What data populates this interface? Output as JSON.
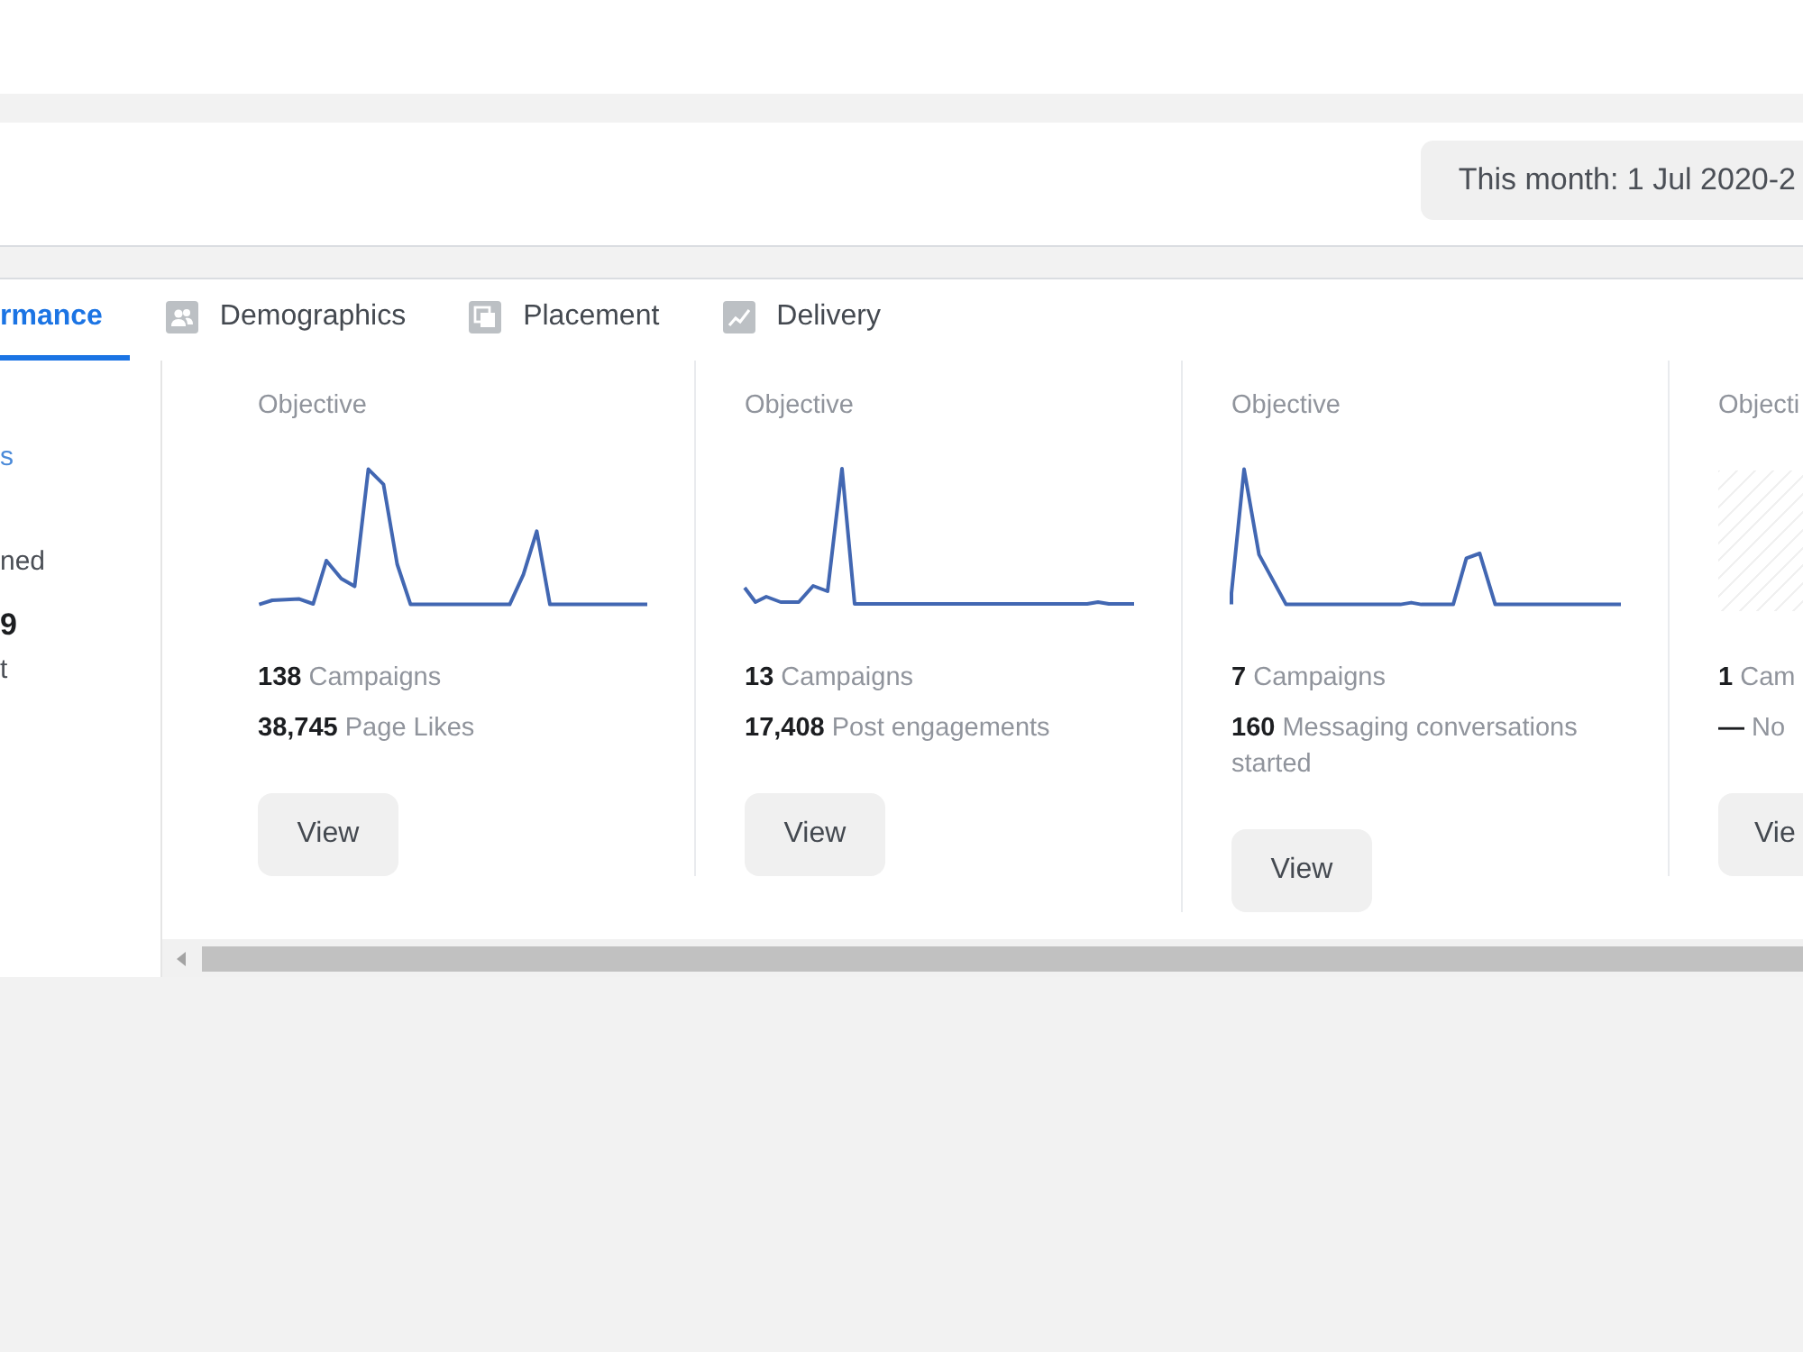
{
  "date_range": {
    "label": "This month: 1 Jul 2020-2"
  },
  "tabs": [
    {
      "label": "rmance",
      "selected": true
    },
    {
      "label": "Demographics",
      "selected": false
    },
    {
      "label": "Placement",
      "selected": false
    },
    {
      "label": "Delivery",
      "selected": false
    }
  ],
  "left_panel": {
    "link": "s",
    "stat": {
      "label": "ned",
      "value": "9",
      "sublabel": "t"
    }
  },
  "cards": [
    {
      "title": "Objective",
      "kind": "sparkline",
      "campaigns": "**138** Campaigns",
      "result": "**38,745** Page Likes",
      "button": "View"
    },
    {
      "title": "Objective",
      "kind": "sparkline",
      "campaigns": "**13** Campaigns",
      "result": "**17,408** Post engagements",
      "button": "View"
    },
    {
      "title": "Objective",
      "kind": "sparkline",
      "campaigns": "**7** Campaigns",
      "result": "**160** Messaging conversations started",
      "button": "View"
    },
    {
      "title": "Objecti",
      "kind": "empty",
      "campaigns": "**1** Cam",
      "result": "**—** No",
      "button": "Vie"
    }
  ]
}
